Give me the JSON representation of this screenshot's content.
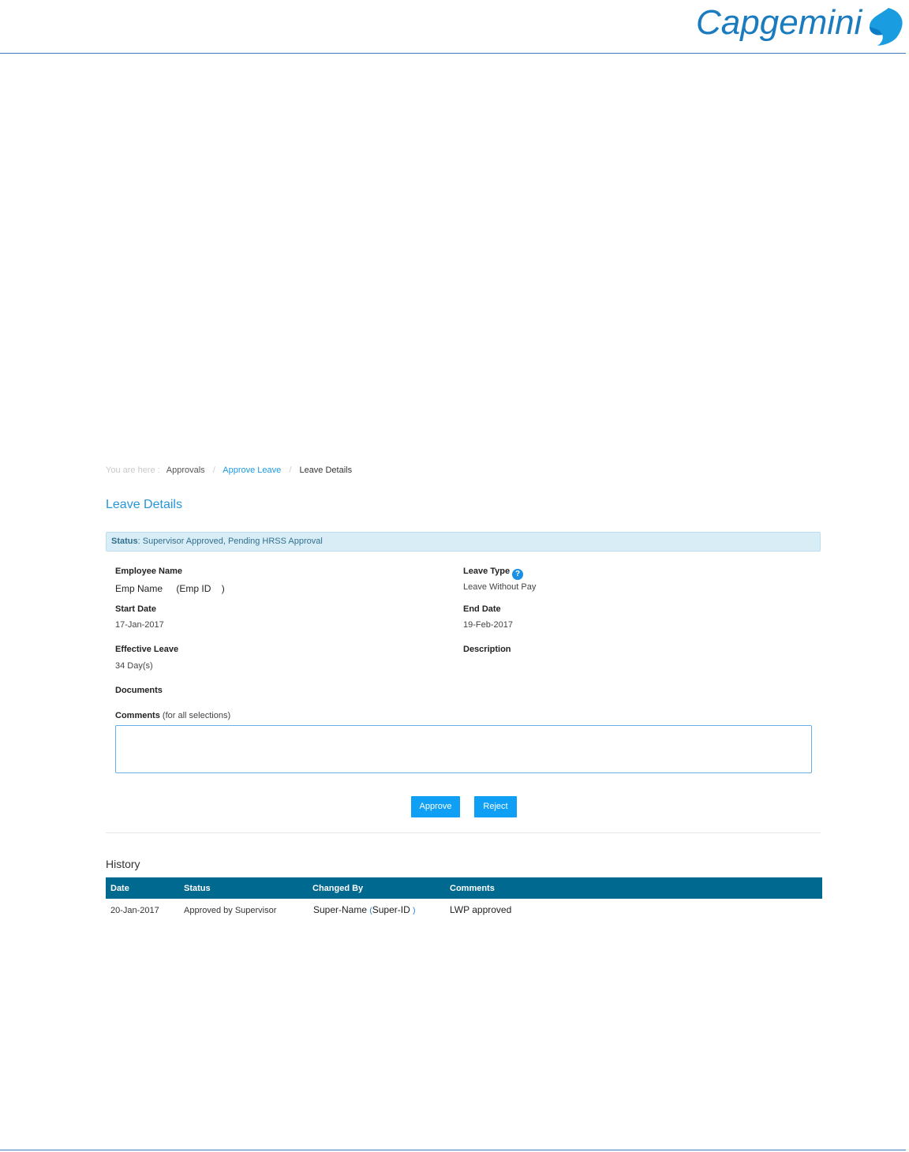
{
  "header": {
    "logo_text": "Capgemini",
    "logo_color": "#1a7bbf"
  },
  "breadcrumb": {
    "prefix": "You are here :",
    "items": [
      "Approvals",
      "Approve Leave",
      "Leave Details"
    ]
  },
  "page_title": "Leave Details",
  "status": {
    "label": "Status",
    "value": ": Supervisor Approved, Pending HRSS Approval"
  },
  "fields": {
    "employee_name": {
      "label": "Employee Name",
      "name": "Emp Name",
      "id_open": "(Emp ID",
      "id_close": ")"
    },
    "leave_type": {
      "label": "Leave Type",
      "value": "Leave Without Pay",
      "help_icon": "?"
    },
    "start_date": {
      "label": "Start Date",
      "value": "17-Jan-2017"
    },
    "end_date": {
      "label": "End Date",
      "value": "19-Feb-2017"
    },
    "effective_leave": {
      "label": "Effective Leave",
      "value": "34 Day(s)"
    },
    "description": {
      "label": "Description",
      "value": ""
    },
    "documents": {
      "label": "Documents"
    },
    "comments": {
      "label": "Comments",
      "note": "(for all selections)",
      "value": ""
    }
  },
  "actions": {
    "approve_label": "Approve",
    "reject_label": "Reject",
    "button_color": "#0fa0f5"
  },
  "history": {
    "title": "History",
    "header_color": "#006990",
    "columns": [
      "Date",
      "Status",
      "Changed By",
      "Comments"
    ],
    "rows": [
      {
        "date": "20-Jan-2017",
        "status": "Approved by Supervisor",
        "changed_by_name": "Super-Name",
        "changed_by_open": "(",
        "changed_by_id": "Super-ID",
        "changed_by_close": ")",
        "comments": "LWP approved"
      }
    ]
  }
}
